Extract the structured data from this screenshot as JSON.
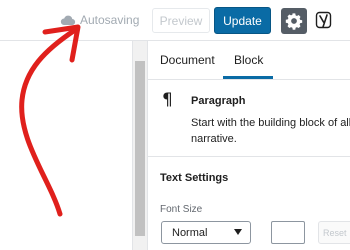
{
  "topbar": {
    "autosave_text": "Autosaving",
    "preview_label": "Preview",
    "update_label": "Update",
    "icons": {
      "autosave": "cloud-icon",
      "settings": "gear-icon",
      "yoast": "yoast-icon"
    }
  },
  "sidebar": {
    "tabs": [
      {
        "label": "Document"
      },
      {
        "label": "Block",
        "active": true
      }
    ],
    "block_card": {
      "icon": "paragraph-icon",
      "title": "Paragraph",
      "description_line1": "Start with the building block of all",
      "description_line2": "narrative."
    },
    "text_settings": {
      "heading": "Text Settings",
      "font_size_label": "Font Size",
      "font_size_value": "Normal",
      "custom_size_value": "",
      "reset_label": "Reset"
    }
  },
  "colors": {
    "accent": "#0a6ba5",
    "annotation_arrow": "#e0201c",
    "settings_button": "#555d66"
  }
}
